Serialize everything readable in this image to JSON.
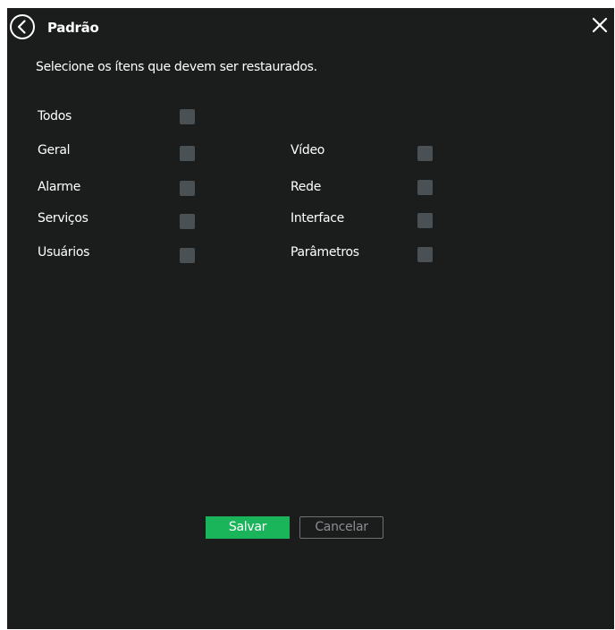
{
  "dialog": {
    "title": "Padrão",
    "back_icon": "circle-chevron-left-icon",
    "close_icon": "close-x-icon",
    "instruction": "Selecione os ítens que devem ser restaurados."
  },
  "options": {
    "todos": {
      "label": "Todos",
      "checked": false
    },
    "geral": {
      "label": "Geral",
      "checked": false
    },
    "video": {
      "label": "Vídeo",
      "checked": false
    },
    "alarme": {
      "label": "Alarme",
      "checked": false
    },
    "rede": {
      "label": "Rede",
      "checked": false
    },
    "servicos": {
      "label": "Serviços",
      "checked": false
    },
    "interface": {
      "label": "Interface",
      "checked": false
    },
    "usuarios": {
      "label": "Usuários",
      "checked": false
    },
    "parametros": {
      "label": "Parâmetros",
      "checked": false
    }
  },
  "buttons": {
    "save_label": "Salvar",
    "cancel_label": "Cancelar"
  },
  "colors": {
    "background": "#1b1d1d",
    "checkbox": "#4a5154",
    "accent": "#1ab55a",
    "text": "#ffffff",
    "muted_text": "#8a8e90"
  }
}
